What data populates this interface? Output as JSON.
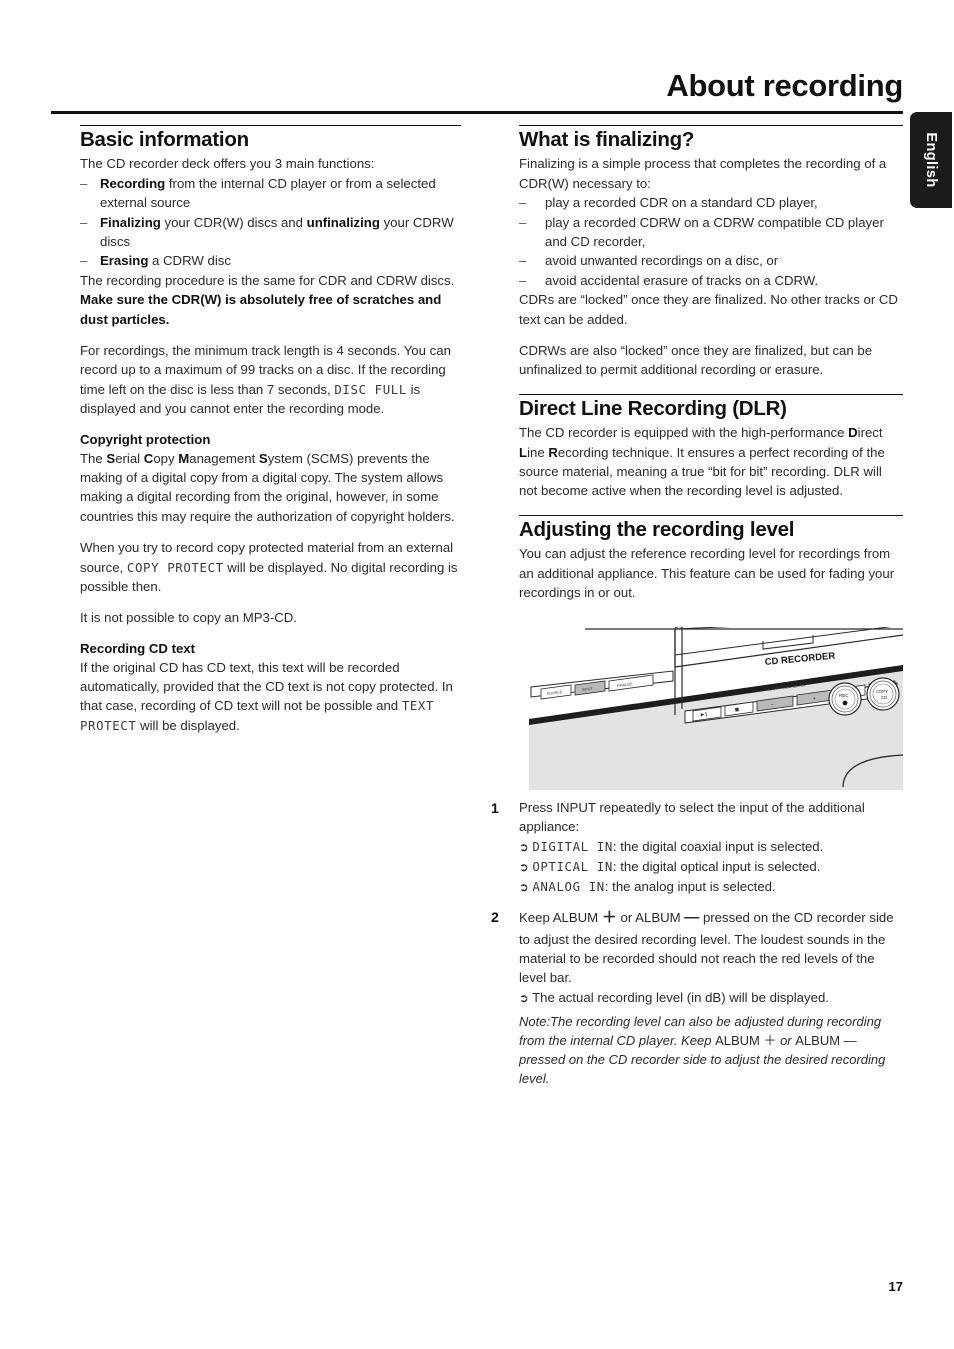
{
  "header": {
    "title": "About recording",
    "language_tab": "English",
    "page_number": "17"
  },
  "left_column": {
    "section1": {
      "heading": "Basic information",
      "intro": "The CD recorder deck offers you 3 main functions:",
      "functions": [
        {
          "bold": "Recording",
          "rest": " from the internal CD player or from a selected external source"
        },
        {
          "bold": "Finalizing",
          "rest": " your CDR(W) discs and ",
          "bold2": "unfinalizing",
          "rest2": " your CDRW discs"
        },
        {
          "bold": "Erasing",
          "rest": " a CDRW disc"
        }
      ],
      "para_procedure_a": "The recording procedure is the same for CDR and CDRW discs. ",
      "para_procedure_b": "Make sure the CDR(W) is absolutely free of scratches and dust particles.",
      "para_tracks_a": "For recordings, the minimum track length is 4 seconds. You can record up to a maximum of 99 tracks on a disc. If the recording time left on the disc is less than 7 seconds, ",
      "para_tracks_lcd": "DISC FULL",
      "para_tracks_b": " is displayed and you cannot enter the recording mode."
    },
    "copyright": {
      "heading": "Copyright protection",
      "scms_pre": "The ",
      "scms_parts": [
        {
          "cap": "S",
          "rest": "erial "
        },
        {
          "cap": "C",
          "rest": "opy "
        },
        {
          "cap": "M",
          "rest": "anagement "
        },
        {
          "cap": "S",
          "rest": "ystem"
        }
      ],
      "scms_post": " (SCMS) prevents the making of a digital copy from a digital copy. The system allows making a digital recording from the original, however, in some countries this may require the authorization of copyright holders.",
      "para_protected_a": "When you try to record copy protected material from an external source, ",
      "para_protected_lcd": "COPY PROTECT",
      "para_protected_b": " will be displayed. No digital recording is possible then.",
      "para_mp3": "It is not possible to copy an MP3-CD."
    },
    "cd_text": {
      "heading": "Recording CD text",
      "para_a": "If the original CD has CD text, this text will be recorded automatically, provided that the CD text is not copy protected. In that case, recording of CD text will not be possible and ",
      "para_lcd": "TEXT PROTECT",
      "para_b": " will be displayed."
    }
  },
  "right_column": {
    "finalizing": {
      "heading": "What is finalizing?",
      "intro": "Finalizing is a simple process that completes the recording of a CDR(W) necessary to:",
      "items": [
        "play a recorded CDR on a standard CD player,",
        "play a recorded CDRW on a CDRW compatible CD player and CD recorder,",
        "avoid unwanted recordings on a disc, or",
        "avoid accidental erasure of tracks on a CDRW."
      ],
      "para_cdrs": "CDRs are “locked” once they are finalized. No other tracks or CD text can be added.",
      "para_cdrws": "CDRWs are also “locked” once they are finalized, but can be unfinalized to permit additional recording or erasure."
    },
    "dlr": {
      "heading": "Direct Line Recording (DLR)",
      "para_pre": "The CD recorder is equipped with the high-performance ",
      "caps": [
        {
          "cap": "D",
          "rest": "irect "
        },
        {
          "cap": "L",
          "rest": "ine "
        },
        {
          "cap": "R",
          "rest": "ecording"
        }
      ],
      "para_post": " technique. It ensures a perfect recording of the source material, meaning a true “bit for bit” recording. DLR will not become active when the recording level is adjusted."
    },
    "adjusting": {
      "heading": "Adjusting the recording level",
      "para": "You can adjust the reference recording level for recordings from an additional appliance. This feature can be used for fading your recordings in or out."
    }
  },
  "illustration": {
    "name": "cd-recorder-front-panel",
    "device_label": "CD RECORDER",
    "level_label": "ALBUM / REC LEVEL",
    "buttons": [
      "SOURCE",
      "INPUT",
      "FINALIZE",
      "▶❘",
      "■",
      "–",
      "+",
      "⏮",
      "⏭"
    ],
    "knobs": [
      "REC",
      "COPY"
    ]
  },
  "steps": [
    {
      "number": "1",
      "text": "Press INPUT repeatedly to select the input of the additional appliance:",
      "arrows": [
        {
          "lcd": "DIGITAL IN",
          "rest": ": the digital coaxial input is selected."
        },
        {
          "lcd": "OPTICAL IN",
          "rest": ": the digital optical input is selected."
        },
        {
          "lcd": "ANALOG IN",
          "rest": ": the analog input is selected."
        }
      ]
    },
    {
      "number": "2",
      "text_a": "Keep ALBUM ",
      "plus": "＋",
      "text_b": " or ALBUM ",
      "minus": "—",
      "text_c": " pressed on the CD recorder side to adjust the desired recording level. The loudest sounds in the material to be recorded should not reach the red levels of the level bar.",
      "arrows": [
        {
          "lcd": "",
          "rest": "The actual recording level (in dB) will be displayed."
        }
      ]
    }
  ],
  "note": {
    "label": "Note:",
    "text_a": "The recording level can also be adjusted during recording from the internal CD player. Keep ",
    "album_plus": "ALBUM ＋",
    "text_b": " or ",
    "album_minus": "ALBUM —",
    "text_c": " pressed on the CD recorder side to adjust the desired recording level."
  },
  "colors": {
    "rule": "#111111",
    "tab_bg": "#1b1b1b",
    "tab_text": "#ffffff",
    "body_text": "#2b2b2b"
  }
}
